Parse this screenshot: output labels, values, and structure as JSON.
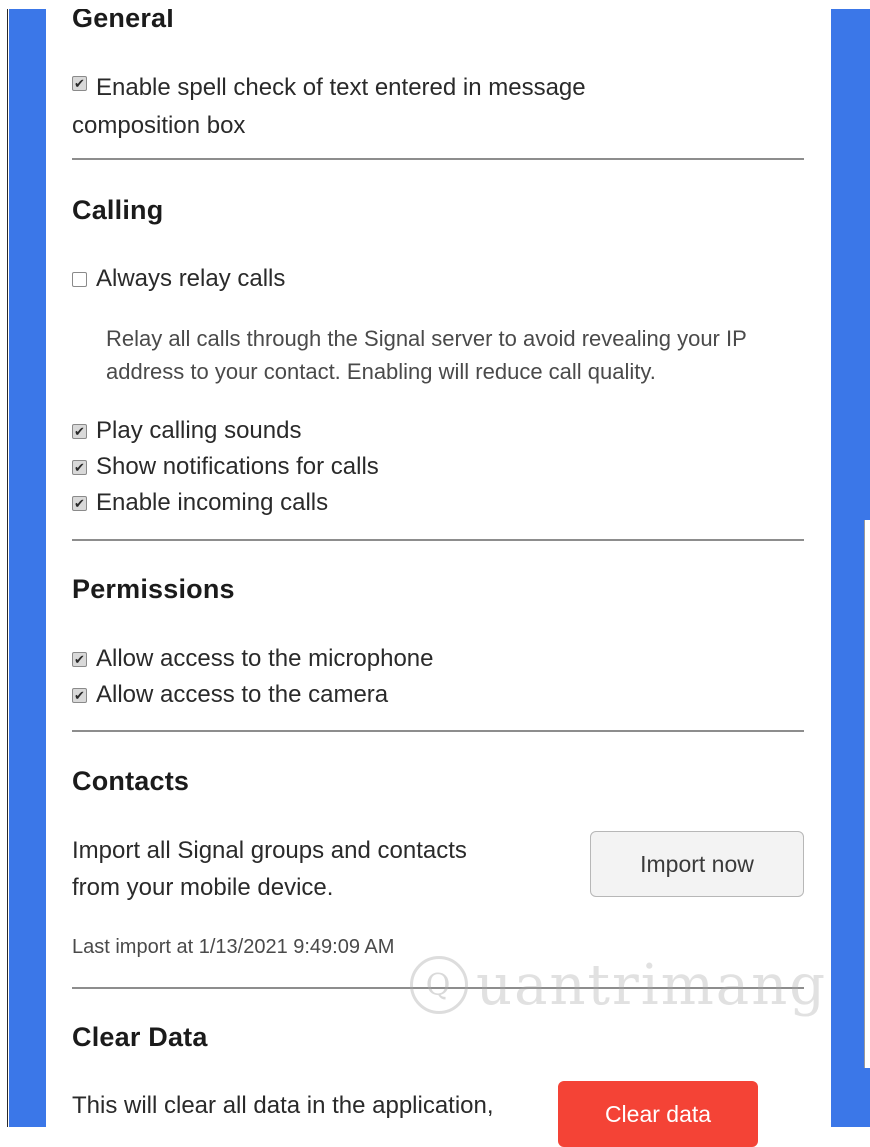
{
  "sections": {
    "general": {
      "heading": "General",
      "spellcheck": {
        "label_line1": "Enable spell check of text entered in message",
        "label_line2": "composition box",
        "checked": true
      }
    },
    "calling": {
      "heading": "Calling",
      "always_relay": {
        "label": "Always relay calls",
        "checked": false
      },
      "relay_desc_line1": "Relay all calls through the Signal server to avoid revealing your IP",
      "relay_desc_line2": "address to your contact. Enabling will reduce call quality.",
      "play_sounds": {
        "label": "Play calling sounds",
        "checked": true
      },
      "show_notifications": {
        "label": "Show notifications for calls",
        "checked": true
      },
      "incoming_calls": {
        "label": "Enable incoming calls",
        "checked": true
      }
    },
    "permissions": {
      "heading": "Permissions",
      "microphone": {
        "label": "Allow access to the microphone",
        "checked": true
      },
      "camera": {
        "label": "Allow access to the camera",
        "checked": true
      }
    },
    "contacts": {
      "heading": "Contacts",
      "import_line1": "Import all Signal groups and contacts",
      "import_line2": "from your mobile device.",
      "import_button": "Import now",
      "last_import": "Last import at 1/13/2021 9:49:09 AM"
    },
    "clear_data": {
      "heading": "Clear Data",
      "desc_line1": "This will clear all data in the application,",
      "clear_button": "Clear data"
    }
  },
  "watermark": {
    "text": "uantrimang",
    "logo_letter": "Q"
  },
  "colors": {
    "accent_blue": "#3b77e8",
    "danger": "#f44336"
  },
  "icons": {
    "checkbox_checked": "check-icon"
  }
}
